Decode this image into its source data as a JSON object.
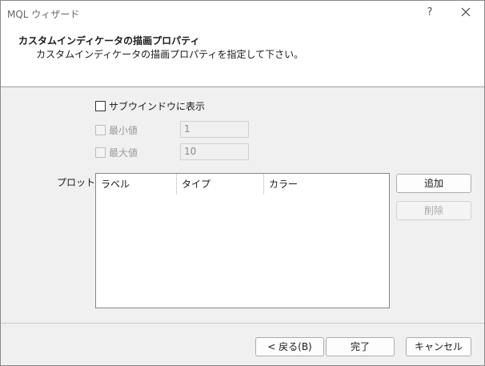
{
  "window": {
    "title": "MQL ウィザード",
    "help_glyph": "?"
  },
  "header": {
    "title": "カスタムインディケータの描画プロパティ",
    "description": "カスタムインディケータの描画プロパティを指定して下さい。"
  },
  "subwindow": {
    "label": "サブウインドウに表示",
    "checked": false
  },
  "min_value": {
    "label": "最小値",
    "value": "1",
    "enabled": false
  },
  "max_value": {
    "label": "最大値",
    "value": "10",
    "enabled": false
  },
  "plots": {
    "label": "プロット:",
    "columns": [
      "ラベル",
      "タイプ",
      "カラー"
    ],
    "rows": [],
    "add_label": "追加",
    "delete_label": "削除"
  },
  "footer": {
    "back_label": "< 戻る(B)",
    "finish_label": "完了",
    "cancel_label": "キャンセル"
  }
}
